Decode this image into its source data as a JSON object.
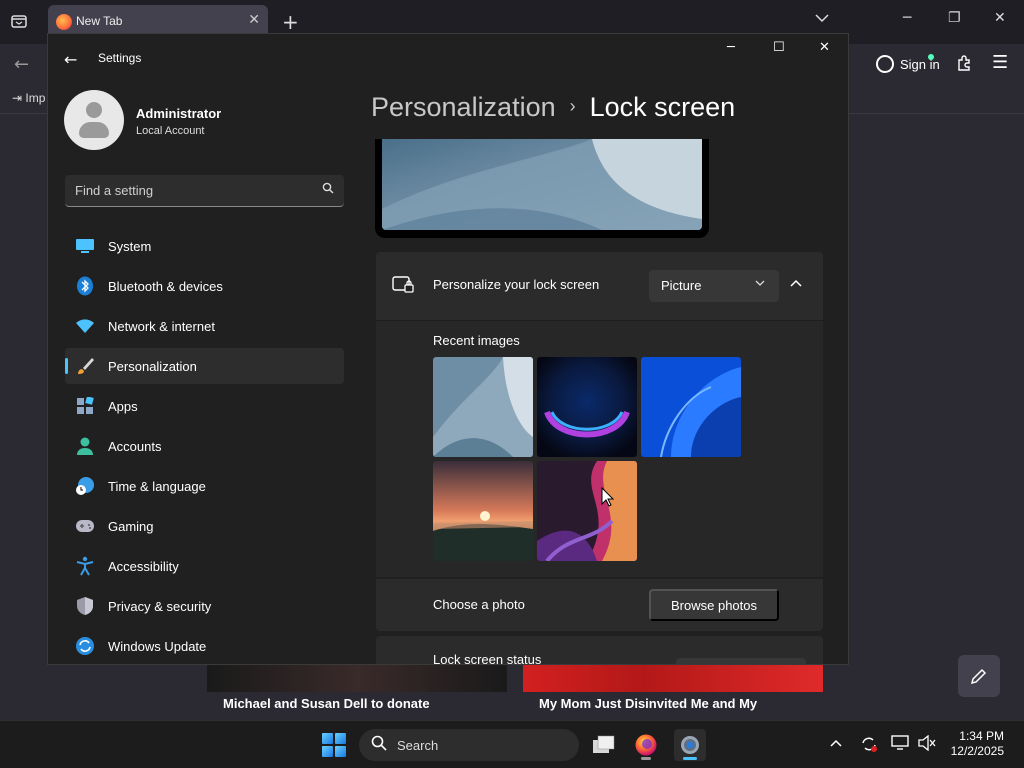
{
  "browser": {
    "tab_title": "New Tab",
    "signin_label": "Sign in",
    "bookmark_import": "Imp",
    "cards": [
      {
        "title": "Michael and Susan Dell to donate"
      },
      {
        "title": "My Mom Just Disinvited Me and My"
      }
    ]
  },
  "settings": {
    "window_title": "Settings",
    "profile": {
      "name": "Administrator",
      "account_type": "Local Account"
    },
    "search_placeholder": "Find a setting",
    "nav": [
      {
        "label": "System",
        "icon": "monitor-icon"
      },
      {
        "label": "Bluetooth & devices",
        "icon": "bluetooth-icon"
      },
      {
        "label": "Network & internet",
        "icon": "wifi-icon"
      },
      {
        "label": "Personalization",
        "icon": "brush-icon",
        "active": true
      },
      {
        "label": "Apps",
        "icon": "apps-icon"
      },
      {
        "label": "Accounts",
        "icon": "person-icon"
      },
      {
        "label": "Time & language",
        "icon": "clock-globe-icon"
      },
      {
        "label": "Gaming",
        "icon": "gamepad-icon"
      },
      {
        "label": "Accessibility",
        "icon": "accessibility-icon"
      },
      {
        "label": "Privacy & security",
        "icon": "shield-icon"
      },
      {
        "label": "Windows Update",
        "icon": "update-icon"
      }
    ],
    "breadcrumb": {
      "parent": "Personalization",
      "separator": "›",
      "current": "Lock screen"
    },
    "personalize": {
      "label": "Personalize your lock screen",
      "selected": "Picture"
    },
    "recent_images_title": "Recent images",
    "choose_photo": {
      "label": "Choose a photo",
      "button": "Browse photos"
    },
    "lock_status_label": "Lock screen status"
  },
  "taskbar": {
    "search_label": "Search",
    "time": "1:34 PM",
    "date": "12/2/2025"
  },
  "colors": {
    "accent": "#4cc2ff",
    "window_bg": "#202020",
    "card_bg": "#2b2b2b"
  }
}
